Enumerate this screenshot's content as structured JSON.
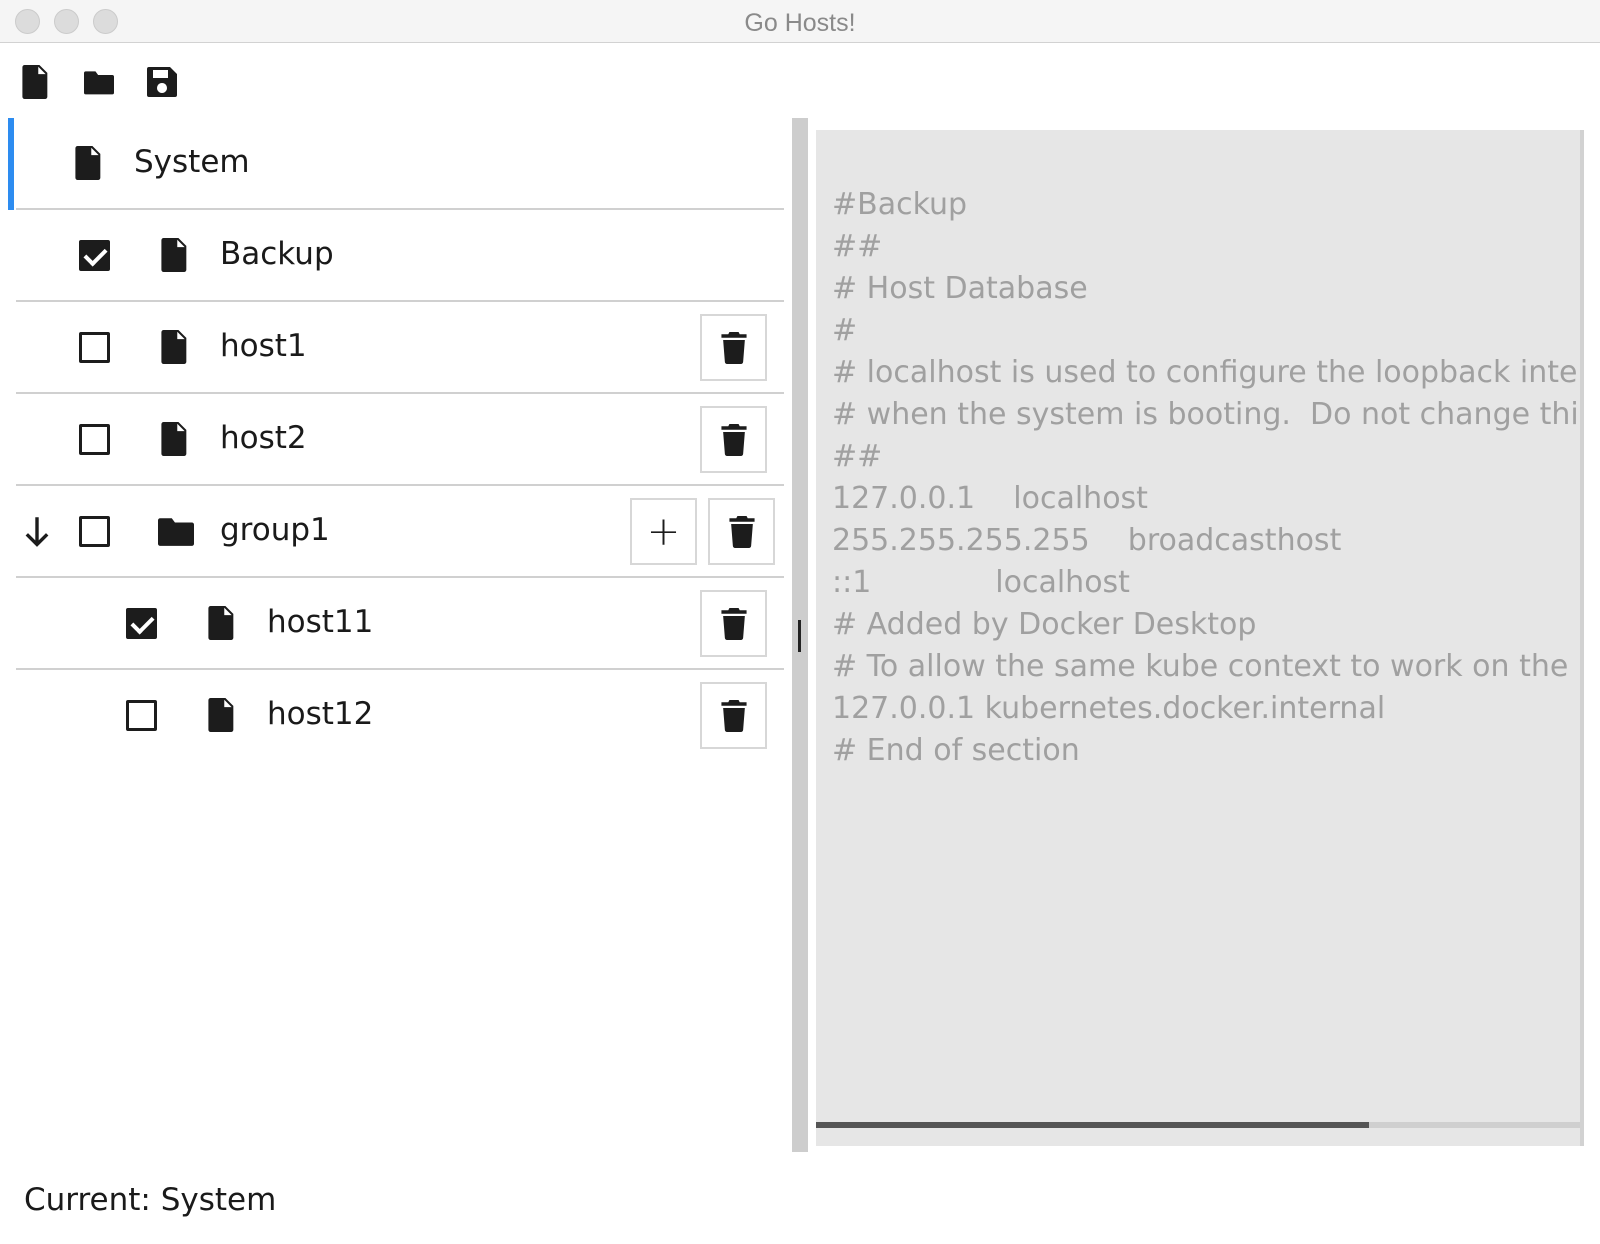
{
  "window": {
    "title": "Go Hosts!"
  },
  "toolbar": {
    "buttons": [
      {
        "name": "new-file",
        "icon": "file-icon"
      },
      {
        "name": "open-folder",
        "icon": "folder-icon"
      },
      {
        "name": "save",
        "icon": "save-icon"
      }
    ]
  },
  "tree": {
    "rows": [
      {
        "label": "System",
        "type": "file",
        "selected": true
      },
      {
        "label": "Backup",
        "type": "file",
        "checked": true
      },
      {
        "label": "host1",
        "type": "file",
        "checked": false
      },
      {
        "label": "host2",
        "type": "file",
        "checked": false
      },
      {
        "label": "group1",
        "type": "folder",
        "checked": false,
        "expanded": true
      },
      {
        "label": "host11",
        "type": "file",
        "checked": true,
        "parent": "group1"
      },
      {
        "label": "host12",
        "type": "file",
        "checked": false,
        "parent": "group1"
      }
    ]
  },
  "editor": {
    "content": "#Backup\n##\n# Host Database\n#\n# localhost is used to configure the loopback interface\n# when the system is booting.  Do not change this entry.\n##\n127.0.0.1    localhost\n255.255.255.255    broadcasthost\n::1             localhost\n# Added by Docker Desktop\n# To allow the same kube context to work on the host and the container:\n127.0.0.1 kubernetes.docker.internal\n# End of section",
    "hscroll_fraction": 0.72
  },
  "status": {
    "text": "Current: System"
  },
  "colors": {
    "accent": "#2d8cf0",
    "editor_bg": "#e6e6e6",
    "editor_text": "#a0a0a0"
  }
}
